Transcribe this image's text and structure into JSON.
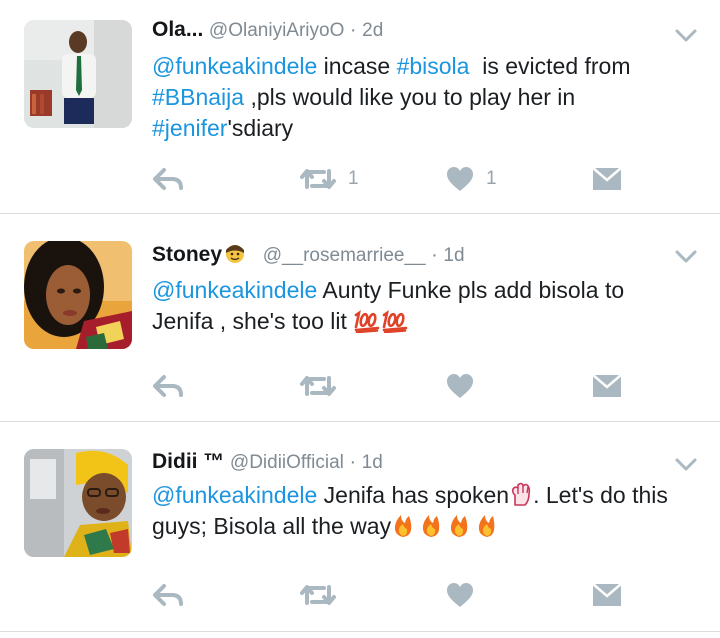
{
  "tweets": [
    {
      "name": "Ola...",
      "handle": "@OlaniyiAriyoO",
      "sep": "·",
      "time": "2d",
      "text_lines": [
        [
          {
            "t": "@funkeakindele",
            "link": true
          },
          {
            "t": " incase ",
            "link": false
          },
          {
            "t": "#bisola",
            "link": true
          },
          {
            "t": "  is evicted from",
            "link": false
          }
        ],
        [
          {
            "t": "#BBnaija",
            "link": true
          },
          {
            "t": " ,pls would like you to play her in",
            "link": false
          }
        ],
        [
          {
            "t": "#jenifer",
            "link": true
          },
          {
            "t": "'sdiary",
            "link": false
          }
        ]
      ],
      "retweet_count": "1",
      "like_count": "1"
    },
    {
      "name": "Stoney",
      "handle": "@__rosemarriee__",
      "sep": "·",
      "time": "1d",
      "text_lines": [
        [
          {
            "t": "@funkeakindele",
            "link": true
          },
          {
            "t": " Aunty Funke pls add bisola to",
            "link": false
          }
        ],
        [
          {
            "t": "Jenifa , she's too lit ",
            "link": false
          }
        ]
      ],
      "retweet_count": "",
      "like_count": ""
    },
    {
      "name": "Didii ™",
      "handle": "@DidiiOfficial",
      "sep": "·",
      "time": "1d",
      "text_lines": [
        [
          {
            "t": "@funkeakindele",
            "link": true
          },
          {
            "t": " Jenifa has spoken",
            "link": false
          }
        ],
        [
          {
            "t": "guys; Bisola all the way",
            "link": false
          }
        ]
      ],
      "text_after_emoji": ". Let's do this",
      "retweet_count": "",
      "like_count": ""
    }
  ],
  "icons": {
    "reply": "reply-icon",
    "retweet": "retweet-icon",
    "like": "heart-icon",
    "dm": "envelope-icon",
    "caret": "chevron-down-icon"
  },
  "colors": {
    "link": "#1b95e0",
    "meta": "#808a93",
    "action": "#aab8c2",
    "divider": "#d9dde0"
  }
}
